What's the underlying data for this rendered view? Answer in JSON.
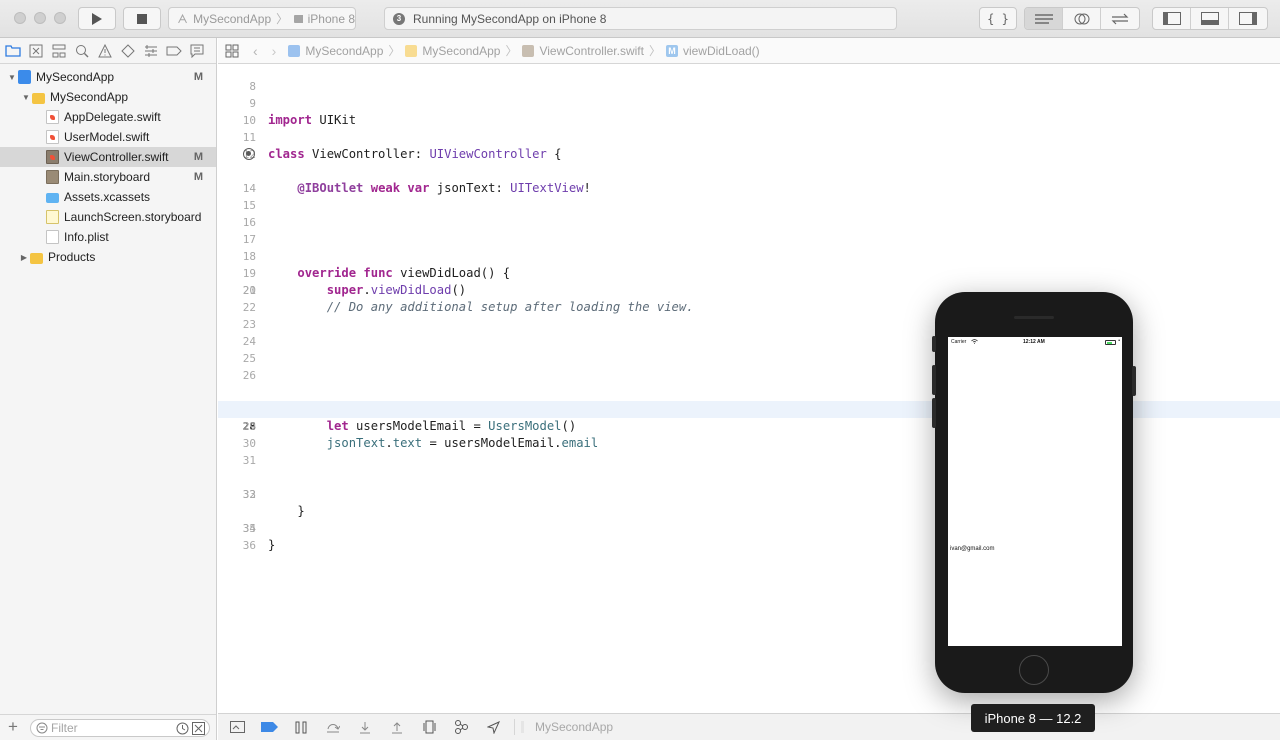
{
  "toolbar": {
    "scheme_app": "MySecondApp",
    "scheme_device": "iPhone 8",
    "activity_count": "3",
    "activity_status": "Running MySecondApp on iPhone 8"
  },
  "navigator": {
    "items": [
      {
        "label": "MySecondApp",
        "badge": "M"
      },
      {
        "label": "MySecondApp",
        "badge": ""
      },
      {
        "label": "AppDelegate.swift",
        "badge": ""
      },
      {
        "label": "UserModel.swift",
        "badge": ""
      },
      {
        "label": "ViewController.swift",
        "badge": "M"
      },
      {
        "label": "Main.storyboard",
        "badge": "M"
      },
      {
        "label": "Assets.xcassets",
        "badge": ""
      },
      {
        "label": "LaunchScreen.storyboard",
        "badge": ""
      },
      {
        "label": "Info.plist",
        "badge": ""
      },
      {
        "label": "Products",
        "badge": ""
      }
    ],
    "filter_placeholder": "Filter"
  },
  "jumpbar": {
    "crumbs": [
      "MySecondApp",
      "MySecondApp",
      "ViewController.swift",
      "viewDidLoad()"
    ]
  },
  "editor": {
    "lines": [
      {
        "n": "8",
        "code": ""
      },
      {
        "n": "9",
        "code": "import UIKit"
      },
      {
        "n": "10",
        "code": ""
      },
      {
        "n": "11",
        "code": "class ViewController: UIViewController {"
      },
      {
        "n": "12",
        "code": ""
      },
      {
        "n": "13",
        "code": "    @IBOutlet weak var jsonText: UITextView!"
      },
      {
        "n": "14",
        "code": ""
      },
      {
        "n": "15",
        "code": ""
      },
      {
        "n": "16",
        "code": ""
      },
      {
        "n": "17",
        "code": ""
      },
      {
        "n": "18",
        "code": "    override func viewDidLoad() {"
      },
      {
        "n": "19",
        "code": "        super.viewDidLoad()"
      },
      {
        "n": "20",
        "code": "        // Do any additional setup after loading the view."
      },
      {
        "n": "21",
        "code": ""
      },
      {
        "n": "22",
        "code": ""
      },
      {
        "n": "23",
        "code": ""
      },
      {
        "n": "24",
        "code": ""
      },
      {
        "n": "25",
        "code": ""
      },
      {
        "n": "26",
        "code": ""
      },
      {
        "n": "27",
        "code": "        let usersModelEmail = UsersModel()"
      },
      {
        "n": "28",
        "code": "        jsonText.text = usersModelEmail.email"
      },
      {
        "n": "29",
        "code": ""
      },
      {
        "n": "30",
        "code": ""
      },
      {
        "n": "31",
        "code": ""
      },
      {
        "n": "32",
        "code": "    }"
      },
      {
        "n": "33",
        "code": ""
      },
      {
        "n": "34",
        "code": "}"
      },
      {
        "n": "35",
        "code": ""
      },
      {
        "n": "36",
        "code": ""
      }
    ],
    "current_line": "28"
  },
  "debugbar": {
    "process": "MySecondApp"
  },
  "simulator": {
    "carrier": "Carrier",
    "time": "12:12 AM",
    "json_text": "ivan@gmail.com",
    "device_label": "iPhone 8 — 12.2"
  }
}
